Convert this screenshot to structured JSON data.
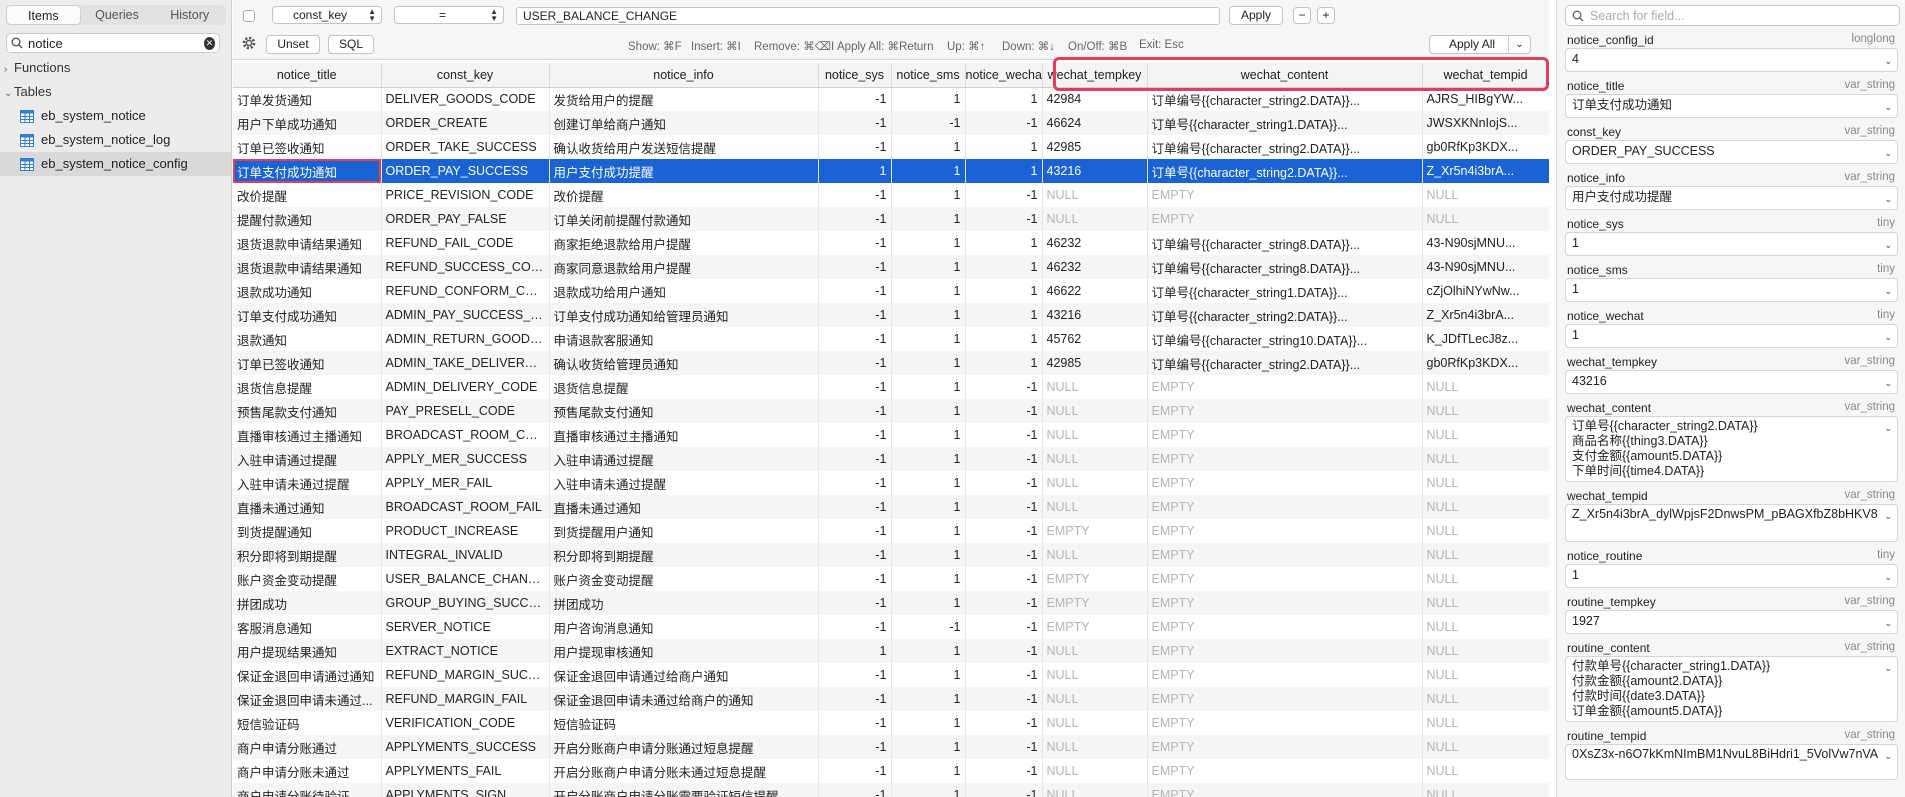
{
  "sidebar": {
    "tabs": [
      "Items",
      "Queries",
      "History"
    ],
    "search_value": "notice",
    "groups": {
      "functions": "Functions",
      "tables": "Tables"
    },
    "tables": [
      "eb_system_notice",
      "eb_system_notice_log",
      "eb_system_notice_config"
    ],
    "selected_table": "eb_system_notice_config"
  },
  "filter": {
    "column": "const_key",
    "operator": "=",
    "value": "USER_BALANCE_CHANGE",
    "apply_label": "Apply",
    "minus_label": "−",
    "plus_label": "+",
    "unset_label": "Unset",
    "sql_label": "SQL",
    "apply_all_label": "Apply All",
    "hints": [
      "Show: ⌘F",
      "Insert: ⌘I",
      "Remove: ⌘⌫I",
      "Apply All: ⌘Return",
      "Up: ⌘↑",
      "Down: ⌘↓",
      "On/Off: ⌘B",
      "Exit: Esc"
    ]
  },
  "grid": {
    "columns": [
      "notice_title",
      "const_key",
      "notice_info",
      "notice_sys",
      "notice_sms",
      "notice_wechat",
      "wechat_tempkey",
      "wechat_content",
      "wechat_tempid"
    ],
    "rows": [
      [
        "订单发货通知",
        "DELIVER_GOODS_CODE",
        "发货给用户的提醒",
        "-1",
        "1",
        "1",
        "42984",
        "订单编号{{character_string2.DATA}}...",
        "AJRS_HIBgYW..."
      ],
      [
        "用户下单成功通知",
        "ORDER_CREATE",
        "创建订单给商户通知",
        "-1",
        "-1",
        "-1",
        "46624",
        "订单号{{character_string1.DATA}}...",
        "JWSXKNnIojS..."
      ],
      [
        "订单已签收通知",
        "ORDER_TAKE_SUCCESS",
        "确认收货给用户发送短信提醒",
        "-1",
        "1",
        "1",
        "42985",
        "订单编号{{character_string2.DATA}}...",
        "gb0RfKp3KDX..."
      ],
      [
        "订单支付成功通知",
        "ORDER_PAY_SUCCESS",
        "用户支付成功提醒",
        "1",
        "1",
        "1",
        "43216",
        "订单号{{character_string2.DATA}}...",
        "Z_Xr5n4i3brA..."
      ],
      [
        "改价提醒",
        "PRICE_REVISION_CODE",
        "改价提醒",
        "-1",
        "1",
        "-1",
        "NULL",
        "EMPTY",
        "NULL"
      ],
      [
        "提醒付款通知",
        "ORDER_PAY_FALSE",
        "订单关闭前提醒付款通知",
        "-1",
        "1",
        "-1",
        "NULL",
        "EMPTY",
        "NULL"
      ],
      [
        "退货退款申请结果通知",
        "REFUND_FAIL_CODE",
        "商家拒绝退款给用户提醒",
        "-1",
        "1",
        "1",
        "46232",
        "订单编号{{character_string8.DATA}}...",
        "43-N90sjMNU..."
      ],
      [
        "退货退款申请结果通知",
        "REFUND_SUCCESS_CODE",
        "商家同意退款给用户提醒",
        "-1",
        "1",
        "1",
        "46232",
        "订单编号{{character_string8.DATA}}...",
        "43-N90sjMNU..."
      ],
      [
        "退款成功通知",
        "REFUND_CONFORM_CODE",
        "退款成功给用户通知",
        "-1",
        "1",
        "1",
        "46622",
        "订单号{{character_string1.DATA}}...",
        "cZjOlhiNYwNw..."
      ],
      [
        "订单支付成功通知",
        "ADMIN_PAY_SUCCESS_C...",
        "订单支付成功通知给管理员通知",
        "-1",
        "1",
        "1",
        "43216",
        "订单号{{character_string2.DATA}}...",
        "Z_Xr5n4i3brA..."
      ],
      [
        "退款通知",
        "ADMIN_RETURN_GOODS...",
        "申请退款客服通知",
        "-1",
        "1",
        "1",
        "45762",
        "订单编号{{character_string10.DATA}}...",
        "K_JDfTLecJ8z..."
      ],
      [
        "订单已签收通知",
        "ADMIN_TAKE_DELIVERY_...",
        "确认收货给管理员通知",
        "-1",
        "1",
        "1",
        "42985",
        "订单编号{{character_string2.DATA}}...",
        "gb0RfKp3KDX..."
      ],
      [
        "退货信息提醒",
        "ADMIN_DELIVERY_CODE",
        "退货信息提醒",
        "-1",
        "1",
        "-1",
        "NULL",
        "EMPTY",
        "NULL"
      ],
      [
        "预售尾款支付通知",
        "PAY_PRESELL_CODE",
        "预售尾款支付通知",
        "-1",
        "1",
        "-1",
        "NULL",
        "EMPTY",
        "NULL"
      ],
      [
        "直播审核通过主播通知",
        "BROADCAST_ROOM_CODE",
        "直播审核通过主播通知",
        "-1",
        "1",
        "-1",
        "NULL",
        "EMPTY",
        "NULL"
      ],
      [
        "入驻申请通过提醒",
        "APPLY_MER_SUCCESS",
        "入驻申请通过提醒",
        "-1",
        "1",
        "-1",
        "NULL",
        "EMPTY",
        "NULL"
      ],
      [
        "入驻申请未通过提醒",
        "APPLY_MER_FAIL",
        "入驻申请未通过提醒",
        "-1",
        "1",
        "-1",
        "NULL",
        "EMPTY",
        "NULL"
      ],
      [
        "直播未通过通知",
        "BROADCAST_ROOM_FAIL",
        "直播未通过通知",
        "-1",
        "1",
        "-1",
        "NULL",
        "EMPTY",
        "NULL"
      ],
      [
        "到货提醒通知",
        "PRODUCT_INCREASE",
        "到货提醒用户通知",
        "-1",
        "1",
        "-1",
        "EMPTY",
        "EMPTY",
        "NULL"
      ],
      [
        "积分即将到期提醒",
        "INTEGRAL_INVALID",
        "积分即将到期提醒",
        "-1",
        "1",
        "-1",
        "NULL",
        "EMPTY",
        "NULL"
      ],
      [
        "账户资金变动提醒",
        "USER_BALANCE_CHANGE",
        "账户资金变动提醒",
        "-1",
        "1",
        "-1",
        "EMPTY",
        "EMPTY",
        "NULL"
      ],
      [
        "拼团成功",
        "GROUP_BUYING_SUCCESS",
        "拼团成功",
        "-1",
        "1",
        "-1",
        "EMPTY",
        "EMPTY",
        "NULL"
      ],
      [
        "客服消息通知",
        "SERVER_NOTICE",
        "用户咨询消息通知",
        "-1",
        "-1",
        "-1",
        "EMPTY",
        "EMPTY",
        "NULL"
      ],
      [
        "用户提现结果通知",
        "EXTRACT_NOTICE",
        "用户提现审核通知",
        "1",
        "1",
        "-1",
        "NULL",
        "EMPTY",
        "NULL"
      ],
      [
        "保证金退回申请通过通知",
        "REFUND_MARGIN_SUCCE...",
        "保证金退回申请通过给商户通知",
        "-1",
        "1",
        "-1",
        "NULL",
        "EMPTY",
        "NULL"
      ],
      [
        "保证金退回申请未通过...",
        "REFUND_MARGIN_FAIL",
        "保证金退回申请未通过给商户的通知",
        "-1",
        "1",
        "-1",
        "NULL",
        "EMPTY",
        "NULL"
      ],
      [
        "短信验证码",
        "VERIFICATION_CODE",
        "短信验证码",
        "-1",
        "1",
        "-1",
        "NULL",
        "EMPTY",
        "NULL"
      ],
      [
        "商户申请分账通过",
        "APPLYMENTS_SUCCESS",
        "开启分账商户申请分账通过短息提醒",
        "-1",
        "1",
        "-1",
        "NULL",
        "EMPTY",
        "NULL"
      ],
      [
        "商户申请分账未通过",
        "APPLYMENTS_FAIL",
        "开启分账商户申请分账未通过短息提醒",
        "-1",
        "1",
        "-1",
        "NULL",
        "EMPTY",
        "NULL"
      ],
      [
        "商户申请分账待验证",
        "APPLYMENTS_SIGN",
        "开启分账商户申请分账需要验证短信提醒",
        "-1",
        "1",
        "-1",
        "NULL",
        "EMPTY",
        "NULL"
      ]
    ],
    "selected_row": 3
  },
  "panel": {
    "search_placeholder": "Search for field...",
    "fields": [
      {
        "name": "notice_config_id",
        "type": "longlong",
        "value": "4"
      },
      {
        "name": "notice_title",
        "type": "var_string",
        "value": "订单支付成功通知"
      },
      {
        "name": "const_key",
        "type": "var_string",
        "value": "ORDER_PAY_SUCCESS"
      },
      {
        "name": "notice_info",
        "type": "var_string",
        "value": "用户支付成功提醒"
      },
      {
        "name": "notice_sys",
        "type": "tiny",
        "value": "1"
      },
      {
        "name": "notice_sms",
        "type": "tiny",
        "value": "1"
      },
      {
        "name": "notice_wechat",
        "type": "tiny",
        "value": "1"
      },
      {
        "name": "wechat_tempkey",
        "type": "var_string",
        "value": "43216"
      },
      {
        "name": "wechat_content",
        "type": "var_string",
        "value": "订单号{{character_string2.DATA}}\n商品名称{{thing3.DATA}}\n支付金额{{amount5.DATA}}\n下单时间{{time4.DATA}}"
      },
      {
        "name": "wechat_tempid",
        "type": "var_string",
        "value": "Z_Xr5n4i3brA_dylWpjsF2DnwsPM_pBAGXfbZ8bHKV8"
      },
      {
        "name": "notice_routine",
        "type": "tiny",
        "value": "1"
      },
      {
        "name": "routine_tempkey",
        "type": "var_string",
        "value": "1927"
      },
      {
        "name": "routine_content",
        "type": "var_string",
        "value": "付款单号{{character_string1.DATA}}\n付款金额{{amount2.DATA}}\n付款时间{{date3.DATA}}\n订单金额{{amount5.DATA}}"
      },
      {
        "name": "routine_tempid",
        "type": "var_string",
        "value": "0XsZ3x-n6O7kKmNImBM1NvuL8BiHdri1_5VolVw7nVA"
      }
    ]
  },
  "colors": {
    "selection": "#1a63d5",
    "highlight": "#e43d5a"
  }
}
